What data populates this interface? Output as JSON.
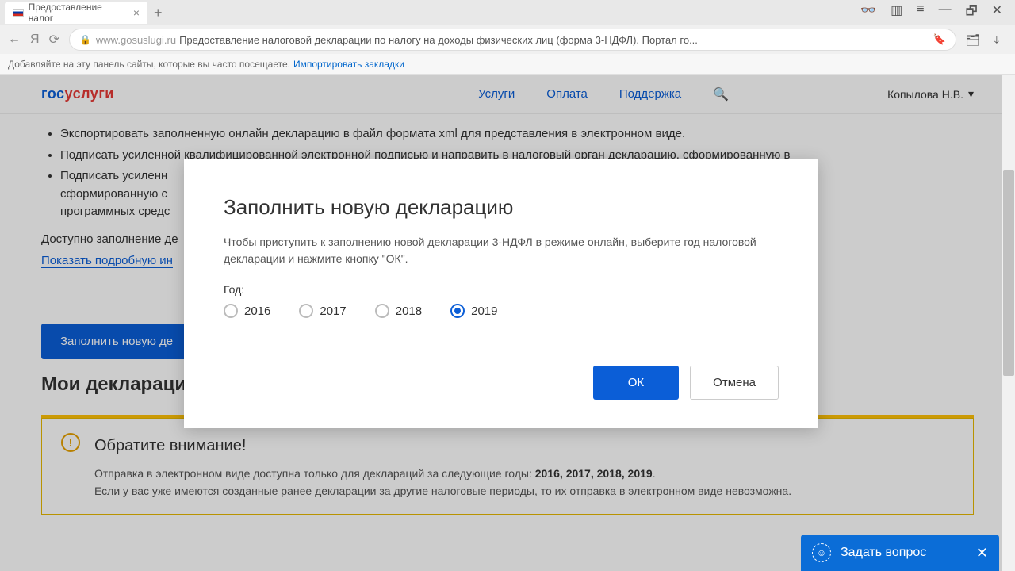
{
  "tab": {
    "title": "Предоставление налог",
    "close": "×"
  },
  "chrome": {
    "add_tab": "+"
  },
  "url": {
    "host": "www.gosuslugi.ru",
    "title": "Предоставление налоговой декларации по налогу на доходы физических лиц (форма 3-НДФЛ). Портал го..."
  },
  "bookmarks": {
    "text": "Добавляйте на эту панель сайты, которые вы часто посещаете.",
    "link": "Импортировать закладки"
  },
  "logo": {
    "p1": "гос",
    "p2": "услуги"
  },
  "nav": {
    "services": "Услуги",
    "payment": "Оплата",
    "support": "Поддержка"
  },
  "user": {
    "name": "Копылова Н.В."
  },
  "content": {
    "li1": "Экспортировать заполненную онлайн декларацию в файл формата xml для представления в электронном виде.",
    "li2": "Подписать усиленной квалифицированной электронной подписью и направить в налоговый орган декларацию, сформированную в",
    "li3a": "Подписать усиленн",
    "li3b": "сформированную с",
    "li3c": "программных средс",
    "paragraph": "Доступно заполнение де",
    "show_more": "Показать подробную ин",
    "primary_btn": "Заполнить новую де",
    "section_title": "Мои деклараци"
  },
  "modal": {
    "title": "Заполнить новую декларацию",
    "text": "Чтобы приступить к заполнению новой декларации 3-НДФЛ в режиме онлайн, выберите год налоговой декларации и нажмите кнопку \"ОК\".",
    "year_label": "Год:",
    "years": [
      "2016",
      "2017",
      "2018",
      "2019"
    ],
    "selected": "2019",
    "ok": "ОК",
    "cancel": "Отмена"
  },
  "notice": {
    "title": "Обратите внимание!",
    "line1_a": "Отправка в электронном виде доступна только для деклараций за следующие годы: ",
    "line1_b": "2016, 2017, 2018, 2019",
    "line1_c": ".",
    "line2": "Если у вас уже имеются созданные ранее декларации за другие налоговые периоды, то их отправка в электронном виде невозможна."
  },
  "ask": {
    "label": "Задать вопрос",
    "close": "✕"
  }
}
